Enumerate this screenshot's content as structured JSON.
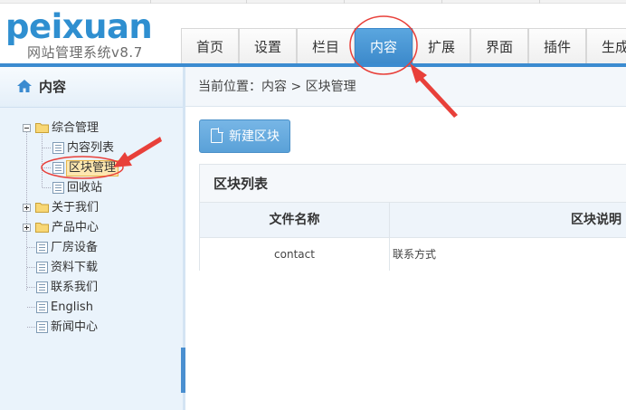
{
  "app": {
    "logo_word": "peixuan",
    "logo_subtitle": "网站管理系统v8.7"
  },
  "nav": {
    "items": [
      {
        "label": "首页"
      },
      {
        "label": "设置"
      },
      {
        "label": "栏目"
      },
      {
        "label": "内容",
        "active": true
      },
      {
        "label": "扩展"
      },
      {
        "label": "界面"
      },
      {
        "label": "插件"
      },
      {
        "label": "生成"
      }
    ]
  },
  "sidebar": {
    "title": "内容",
    "tree": [
      {
        "label": "综合管理",
        "type": "folder",
        "expanded": true
      },
      {
        "label": "内容列表",
        "type": "page"
      },
      {
        "label": "区块管理",
        "type": "page",
        "selected": true
      },
      {
        "label": "回收站",
        "type": "page"
      },
      {
        "label": "关于我们",
        "type": "folder",
        "expanded": false
      },
      {
        "label": "产品中心",
        "type": "folder",
        "expanded": false
      },
      {
        "label": "厂房设备",
        "type": "page"
      },
      {
        "label": "资料下载",
        "type": "page"
      },
      {
        "label": "联系我们",
        "type": "page"
      },
      {
        "label": "English",
        "type": "page"
      },
      {
        "label": "新闻中心",
        "type": "page"
      }
    ]
  },
  "breadcrumb": {
    "text": "当前位置：内容 > 区块管理"
  },
  "toolbar": {
    "new_block_label": "新建区块"
  },
  "panel": {
    "title": "区块列表",
    "columns": [
      "文件名称",
      "区块说明"
    ],
    "rows": [
      [
        "contact",
        "联系方式"
      ]
    ]
  },
  "colors": {
    "accent": "#3b8bd0",
    "annotation": "#e8403a",
    "selected_bg": "#fde7b0"
  }
}
